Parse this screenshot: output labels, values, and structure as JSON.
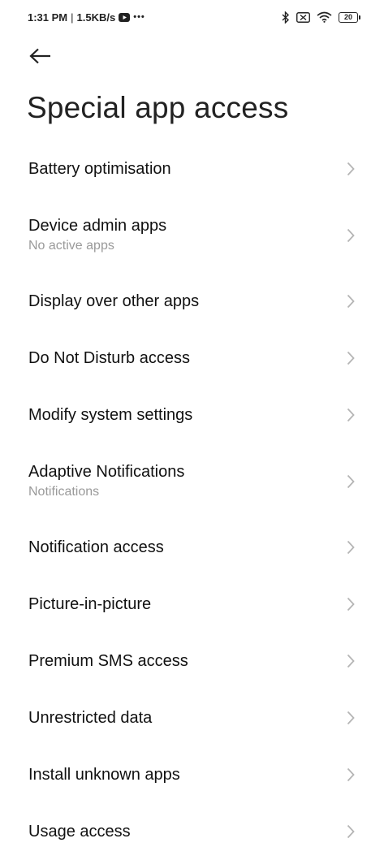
{
  "status_bar": {
    "time": "1:31 PM",
    "separator": "|",
    "speed": "1.5KB/s",
    "more": "•••",
    "battery_level": "20",
    "icons": [
      "youtube-icon",
      "bluetooth-icon",
      "sim-off-icon",
      "wifi-icon",
      "battery-icon"
    ]
  },
  "header": {
    "back_icon": "arrow-left-icon",
    "title": "Special app access"
  },
  "items": [
    {
      "title": "Battery optimisation",
      "subtitle": ""
    },
    {
      "title": "Device admin apps",
      "subtitle": "No active apps"
    },
    {
      "title": "Display over other apps",
      "subtitle": ""
    },
    {
      "title": "Do Not Disturb access",
      "subtitle": ""
    },
    {
      "title": "Modify system settings",
      "subtitle": ""
    },
    {
      "title": "Adaptive Notifications",
      "subtitle": "Notifications"
    },
    {
      "title": "Notification access",
      "subtitle": ""
    },
    {
      "title": "Picture-in-picture",
      "subtitle": ""
    },
    {
      "title": "Premium SMS access",
      "subtitle": ""
    },
    {
      "title": "Unrestricted data",
      "subtitle": ""
    },
    {
      "title": "Install unknown apps",
      "subtitle": ""
    },
    {
      "title": "Usage access",
      "subtitle": ""
    }
  ],
  "colors": {
    "background": "#ffffff",
    "title_text": "#111111",
    "subtitle_text": "#9a9a9a",
    "chevron": "#b5b5b5"
  }
}
